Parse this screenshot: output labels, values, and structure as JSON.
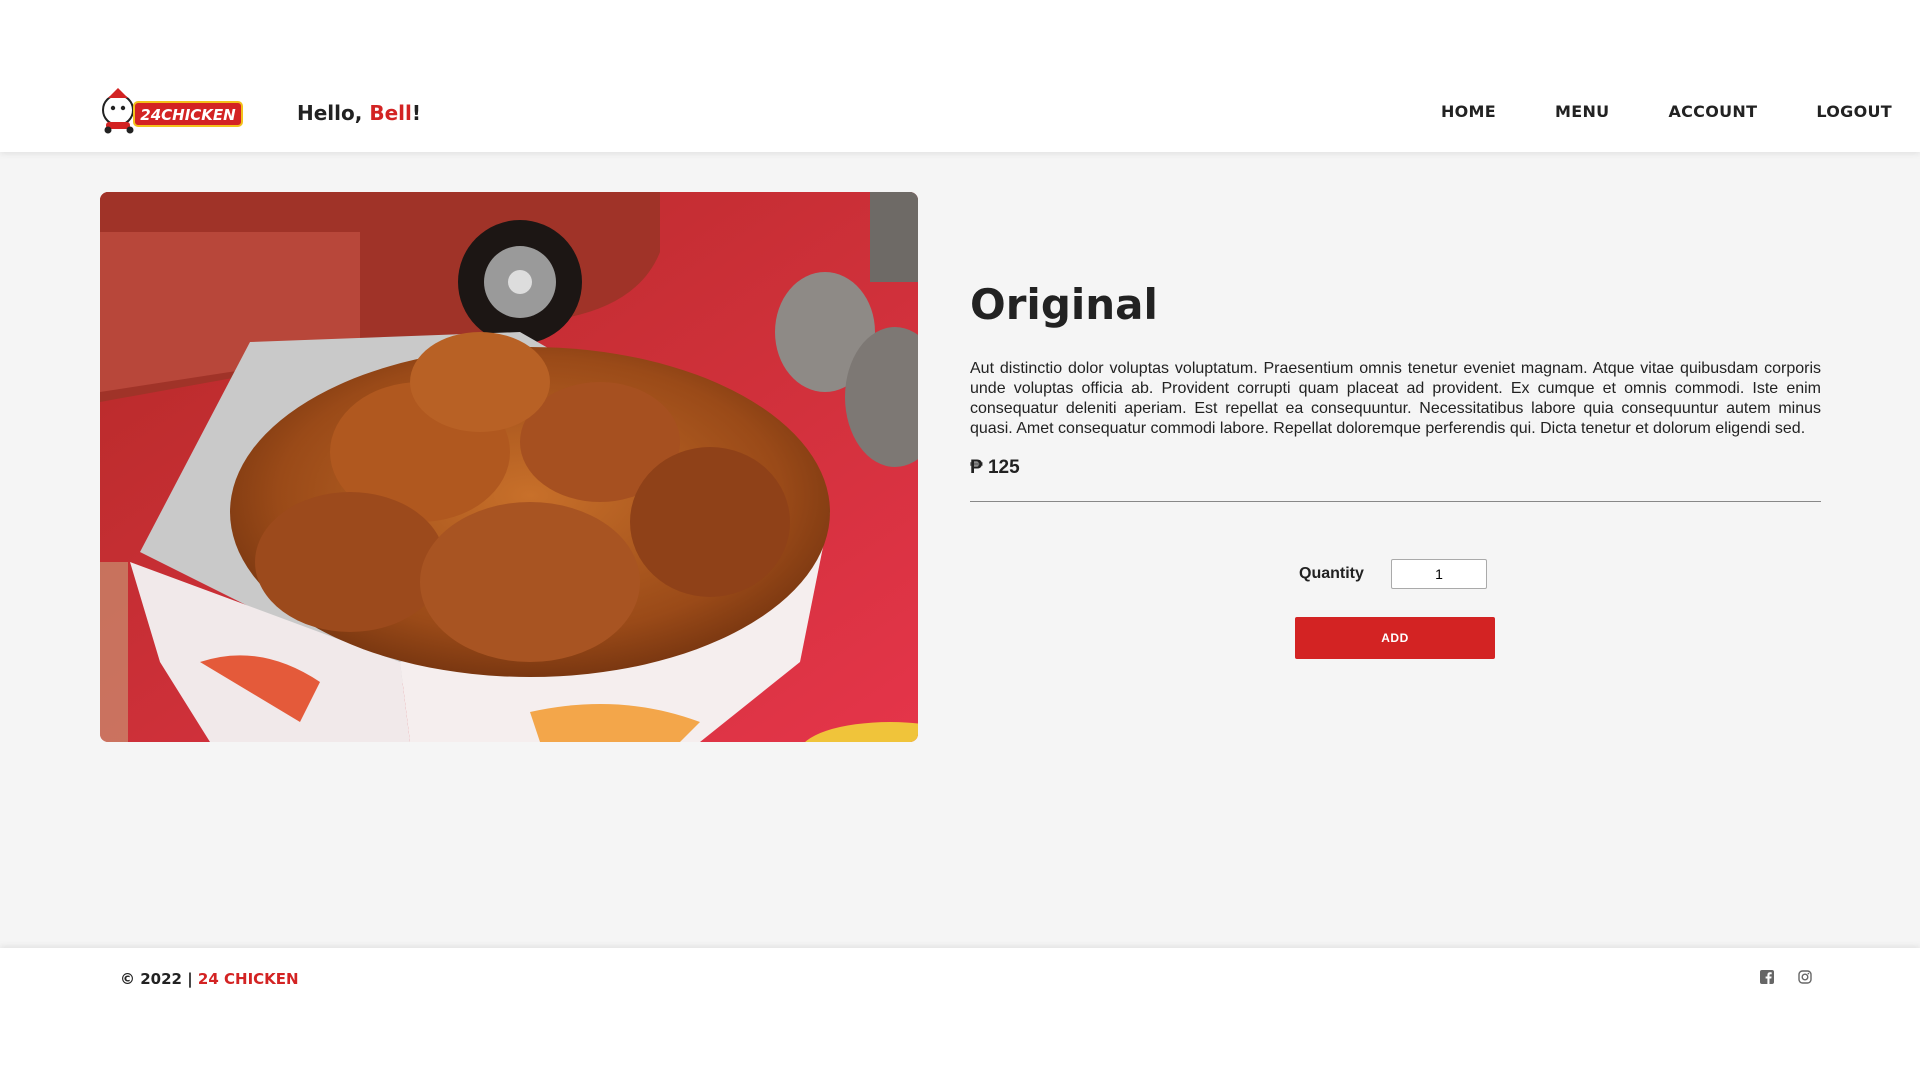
{
  "header": {
    "logo_text": "24CHICKEN",
    "greeting_prefix": "Hello, ",
    "user_name": "Bell",
    "greeting_suffix": "!",
    "nav": [
      "HOME",
      "MENU",
      "ACCOUNT",
      "LOGOUT"
    ]
  },
  "product": {
    "title": "Original",
    "description": "Aut distinctio dolor voluptas voluptatum. Praesentium omnis tenetur eveniet magnam. Atque vitae quibusdam corporis unde voluptas officia ab. Provident corrupti quam placeat ad provident. Ex cumque et omnis commodi. Iste enim consequatur deleniti aperiam. Est repellat ea consequuntur. Necessitatibus labore quia consequuntur autem minus quasi. Amet consequatur commodi labore. Repellat doloremque perferendis qui. Dicta tenetur et dolorum eligendi sed.",
    "price": "₱ 125",
    "quantity_label": "Quantity",
    "quantity_value": "1",
    "add_label": "ADD"
  },
  "footer": {
    "copyright_prefix": "© 2022 | ",
    "brand": "24 CHICKEN"
  },
  "colors": {
    "accent": "#d32323",
    "background": "#f5f5f5"
  },
  "icons": [
    "facebook-icon",
    "instagram-icon"
  ]
}
